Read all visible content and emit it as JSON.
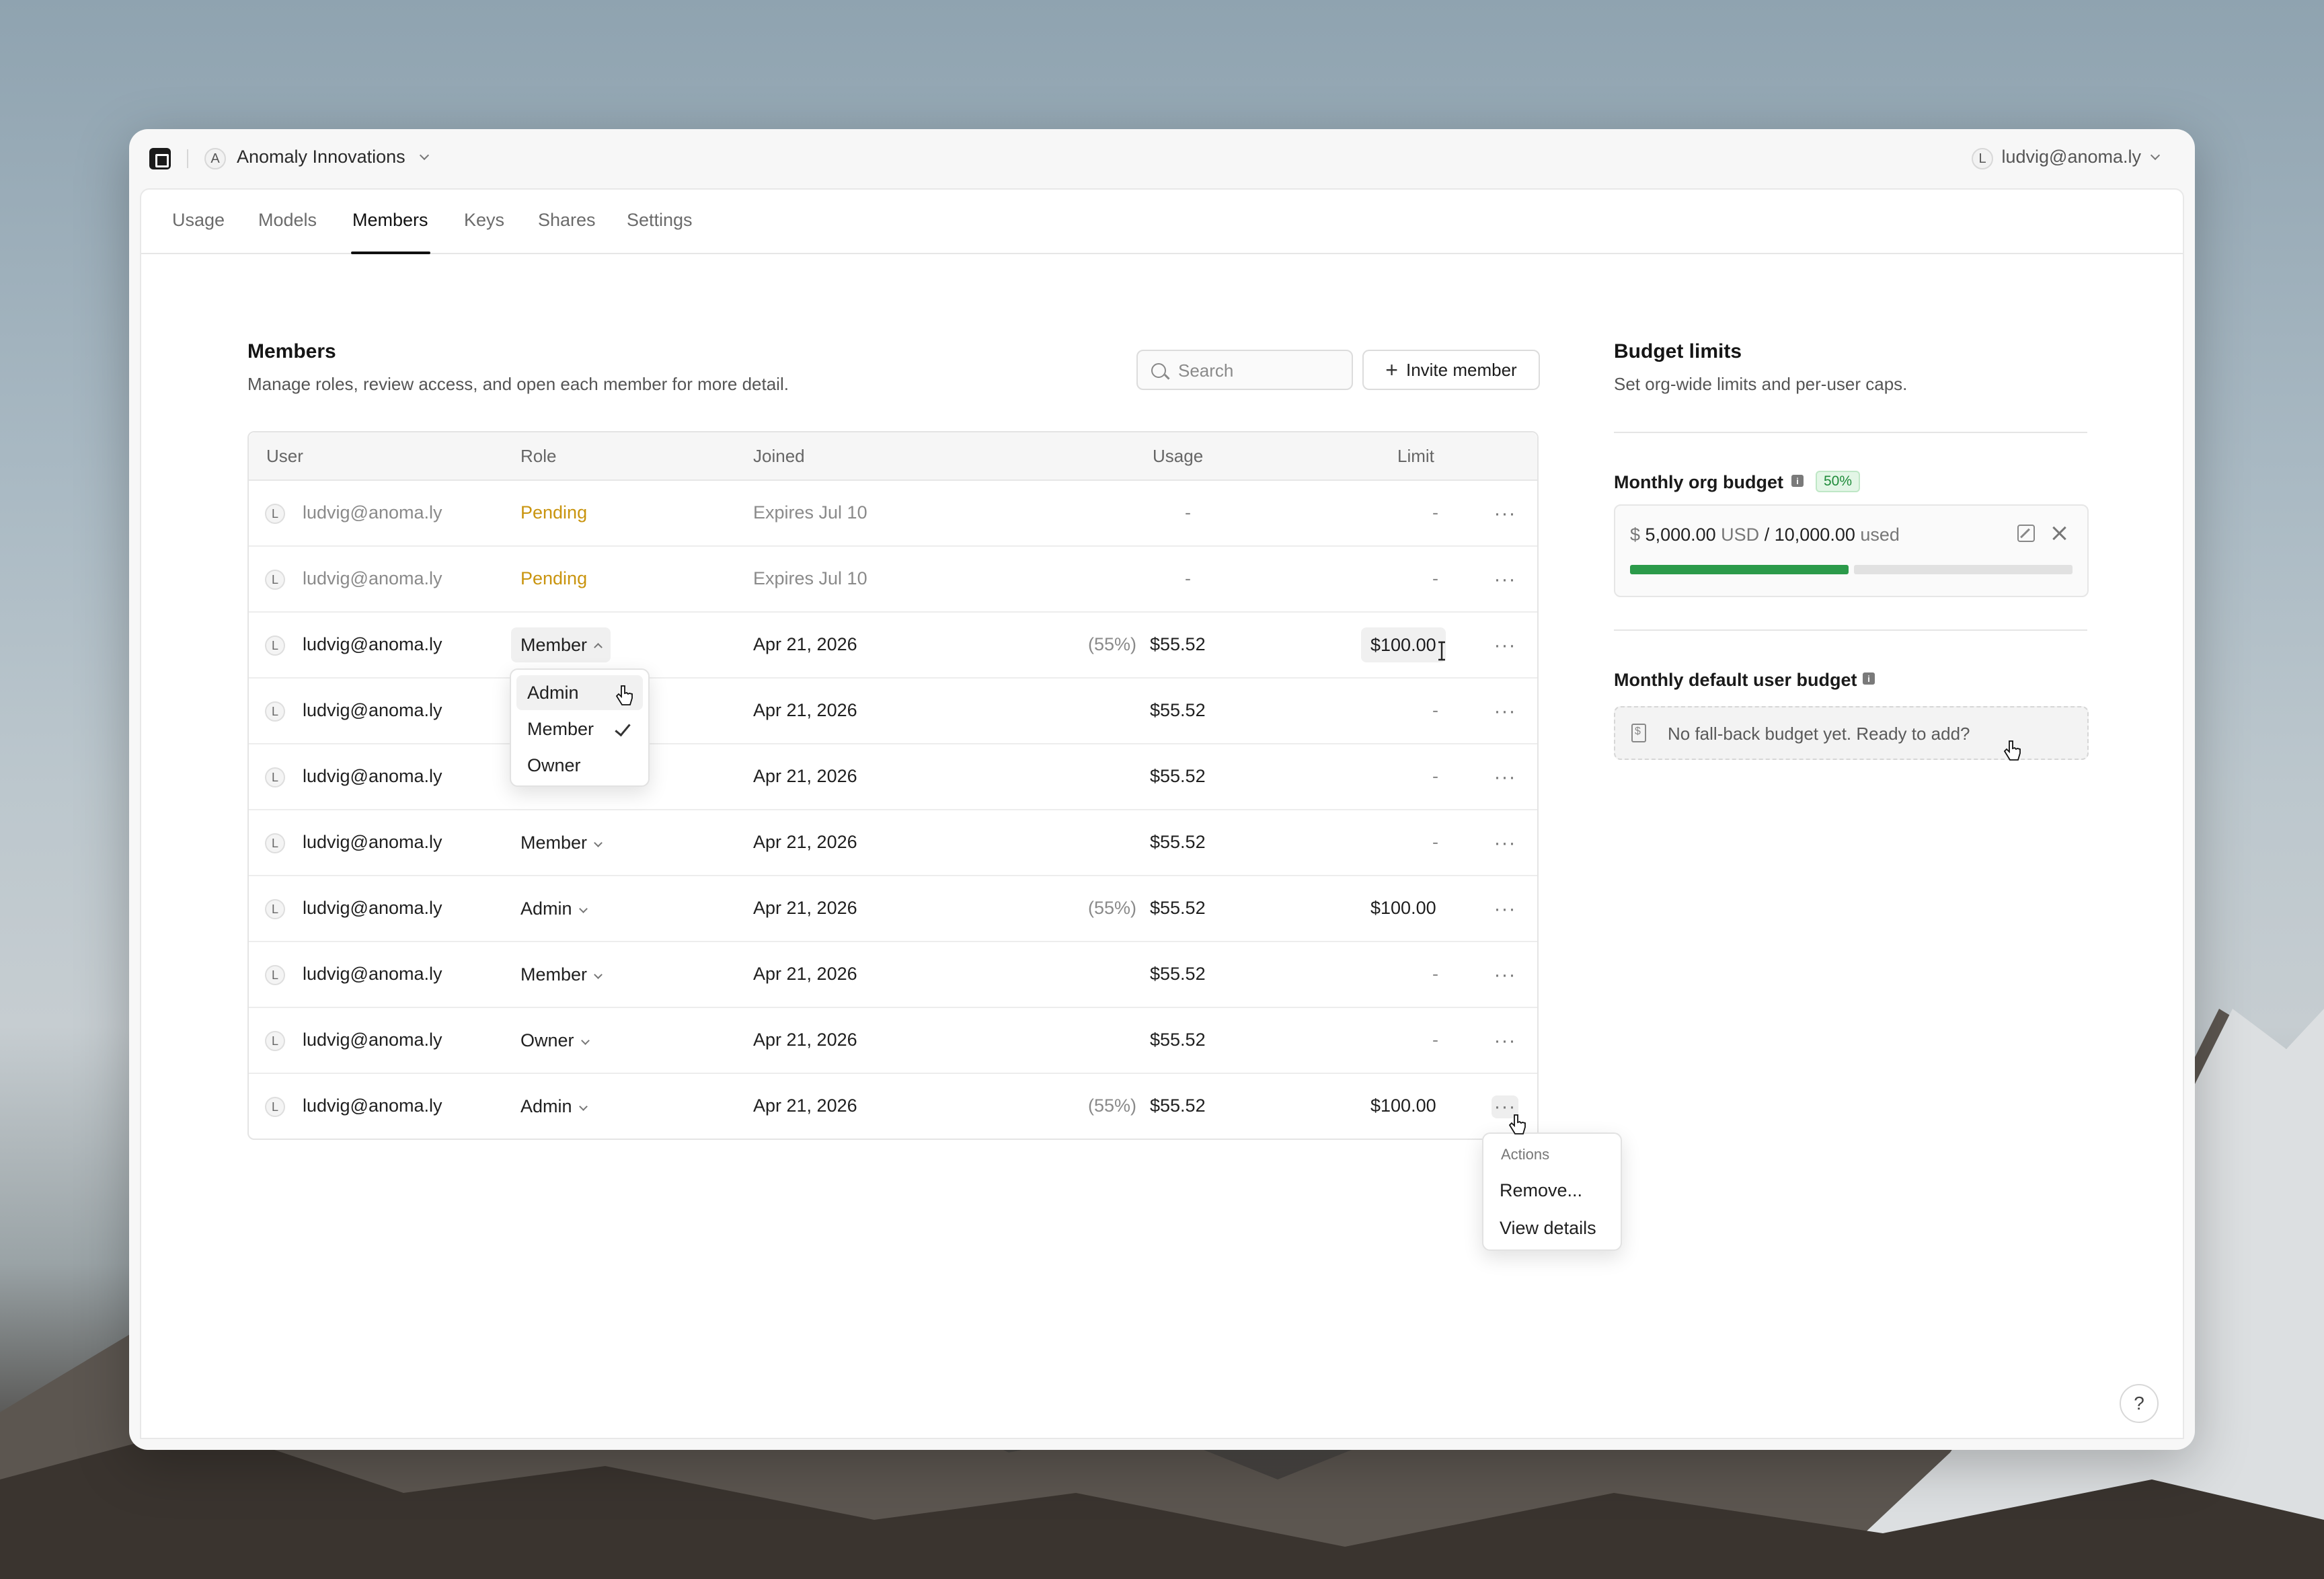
{
  "org": {
    "avatar_letter": "A",
    "name": "Anomaly Innovations"
  },
  "user": {
    "avatar_letter": "L",
    "email": "ludvig@anoma.ly"
  },
  "tabs": [
    {
      "label": "Usage"
    },
    {
      "label": "Models"
    },
    {
      "label": "Members",
      "active": true
    },
    {
      "label": "Keys"
    },
    {
      "label": "Shares"
    },
    {
      "label": "Settings"
    }
  ],
  "members": {
    "title": "Members",
    "subtitle": "Manage roles, review access, and open each member for more detail.",
    "search_placeholder": "Search",
    "invite_label": "Invite member",
    "columns": {
      "user": "User",
      "role": "Role",
      "joined": "Joined",
      "usage": "Usage",
      "limit": "Limit"
    },
    "rows": [
      {
        "avatar": "L",
        "email": "ludvig@anoma.ly",
        "role": "Pending",
        "joined": "Expires Jul 10",
        "pct": "",
        "usage": "-",
        "limit": "-"
      },
      {
        "avatar": "L",
        "email": "ludvig@anoma.ly",
        "role": "Pending",
        "joined": "Expires Jul 10",
        "pct": "",
        "usage": "-",
        "limit": "-"
      },
      {
        "avatar": "L",
        "email": "ludvig@anoma.ly",
        "role": "Member",
        "joined": "Apr 21, 2026",
        "pct": "(55%)",
        "usage": "$55.52",
        "limit": "$100.00"
      },
      {
        "avatar": "L",
        "email": "ludvig@anoma.ly",
        "role": "",
        "joined": "Apr 21, 2026",
        "pct": "",
        "usage": "$55.52",
        "limit": "-"
      },
      {
        "avatar": "L",
        "email": "ludvig@anoma.ly",
        "role": "",
        "joined": "Apr 21, 2026",
        "pct": "",
        "usage": "$55.52",
        "limit": "-"
      },
      {
        "avatar": "L",
        "email": "ludvig@anoma.ly",
        "role": "Member",
        "joined": "Apr 21, 2026",
        "pct": "",
        "usage": "$55.52",
        "limit": "-"
      },
      {
        "avatar": "L",
        "email": "ludvig@anoma.ly",
        "role": "Admin",
        "joined": "Apr 21, 2026",
        "pct": "(55%)",
        "usage": "$55.52",
        "limit": "$100.00"
      },
      {
        "avatar": "L",
        "email": "ludvig@anoma.ly",
        "role": "Member",
        "joined": "Apr 21, 2026",
        "pct": "",
        "usage": "$55.52",
        "limit": "-"
      },
      {
        "avatar": "L",
        "email": "ludvig@anoma.ly",
        "role": "Owner",
        "joined": "Apr 21, 2026",
        "pct": "",
        "usage": "$55.52",
        "limit": "-"
      },
      {
        "avatar": "L",
        "email": "ludvig@anoma.ly",
        "role": "Admin",
        "joined": "Apr 21, 2026",
        "pct": "(55%)",
        "usage": "$55.52",
        "limit": "$100.00"
      }
    ],
    "role_menu": {
      "options": [
        "Admin",
        "Member",
        "Owner"
      ],
      "selected": "Member",
      "hovered": "Admin"
    },
    "actions_menu": {
      "label": "Actions",
      "items": [
        "Remove...",
        "View details"
      ]
    }
  },
  "budget": {
    "title": "Budget limits",
    "subtitle": "Set org-wide limits and per-user caps.",
    "org_budget": {
      "label": "Monthly org budget",
      "info_icon": "i",
      "badge": "50%",
      "currency_symbol": "$",
      "used_amount": "5,000.00",
      "currency": "USD",
      "slash": "/",
      "total": "10,000.00",
      "used_word": "used",
      "progress": 0.5,
      "progress_color": "#2b9a4a"
    },
    "user_budget": {
      "label": "Monthly default user budget",
      "info_icon": "i",
      "empty_text": "No fall-back budget yet. Ready to add?"
    }
  },
  "help_label": "?",
  "colors": {
    "pending": "#c9940e",
    "accent_green": "#2b9a4a"
  }
}
